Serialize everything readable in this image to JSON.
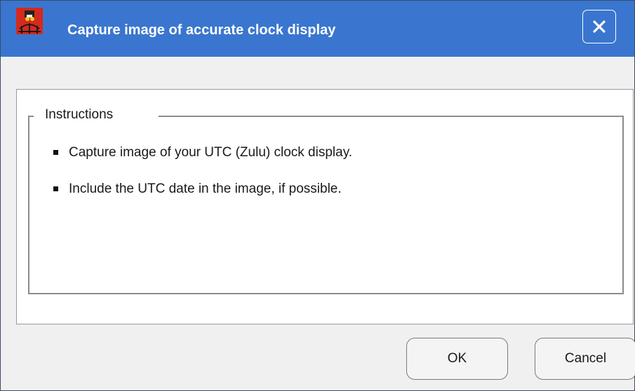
{
  "window": {
    "title": "Capture image of accurate clock display",
    "icon": "film-reel-globe-icon",
    "close": "close-icon",
    "accent": "#3a76cf"
  },
  "instructions": {
    "legend": "Instructions",
    "items": [
      {
        "text": "Capture image of your UTC (Zulu) clock display."
      },
      {
        "text": "Include the UTC date in the image, if possible."
      }
    ]
  },
  "buttons": {
    "ok": "OK",
    "cancel": "Cancel"
  }
}
